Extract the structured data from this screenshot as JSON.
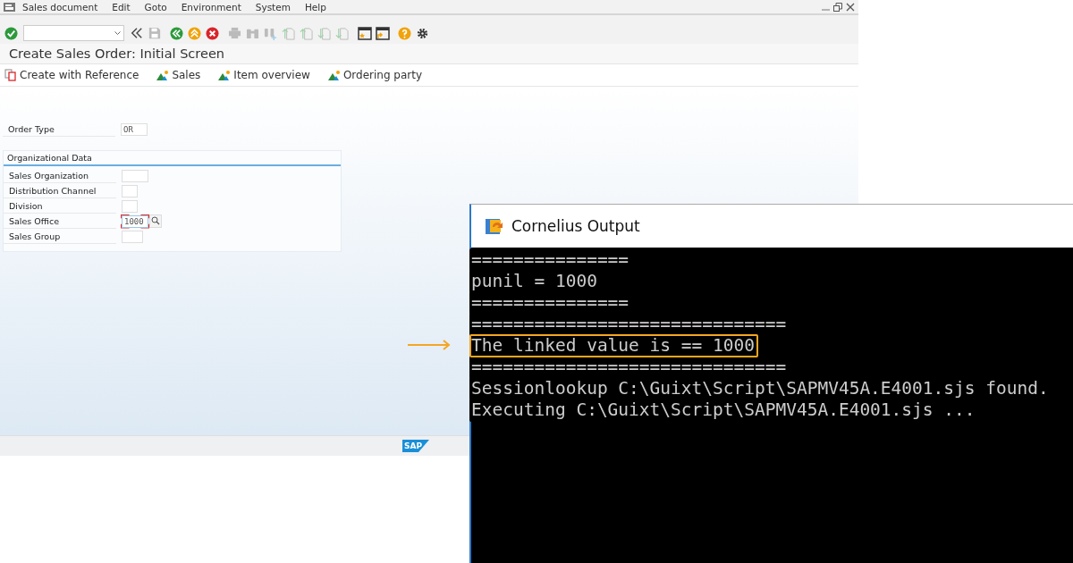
{
  "menu": [
    "Sales document",
    "Edit",
    "Goto",
    "Environment",
    "System",
    "Help"
  ],
  "toolbar": [
    {
      "kind": "check",
      "disabled": false
    },
    {
      "kind": "command"
    },
    {
      "kind": "collapse",
      "disabled": false
    },
    {
      "kind": "save",
      "disabled": true
    },
    {
      "kind": "back",
      "disabled": false
    },
    {
      "kind": "exit",
      "disabled": false
    },
    {
      "kind": "cancel",
      "disabled": false
    },
    {
      "kind": "print",
      "disabled": true
    },
    {
      "kind": "find",
      "disabled": true
    },
    {
      "kind": "find-next",
      "disabled": true
    },
    {
      "kind": "first-page",
      "disabled": true
    },
    {
      "kind": "prev-page",
      "disabled": true
    },
    {
      "kind": "next-page",
      "disabled": true
    },
    {
      "kind": "last-page",
      "disabled": true
    },
    {
      "kind": "new-window",
      "disabled": false
    },
    {
      "kind": "shortcut",
      "disabled": false
    },
    {
      "kind": "help",
      "disabled": false
    },
    {
      "kind": "settings",
      "disabled": false
    }
  ],
  "title": "Create Sales Order: Initial Screen",
  "app_toolbar": [
    {
      "kind": "reference",
      "label": "Create with Reference"
    },
    {
      "kind": "overview",
      "label": "Sales"
    },
    {
      "kind": "overview",
      "label": "Item overview"
    },
    {
      "kind": "overview",
      "label": "Ordering party"
    }
  ],
  "order_type": {
    "label": "Order Type",
    "value": "OR"
  },
  "org_data": {
    "title": "Organizational Data",
    "fields": [
      {
        "label": "Sales Organization",
        "focused": false
      },
      {
        "label": "Distribution Channel",
        "focused": false
      },
      {
        "label": "Division",
        "focused": false
      },
      {
        "label": "Sales Office",
        "value": "1000",
        "focused": true,
        "search_help": true
      },
      {
        "label": "Sales Group",
        "focused": false
      }
    ]
  },
  "sap_logo": "SAP",
  "console": {
    "title": "Cornelius Output",
    "lines": [
      {
        "text": "===============",
        "highlighted": false
      },
      {
        "text": "punil = 1000",
        "highlighted": false
      },
      {
        "text": "===============",
        "highlighted": false
      },
      {
        "text": "==============================",
        "highlighted": false
      },
      {
        "text": "The linked value is == 1000",
        "highlighted": true
      },
      {
        "text": "==============================",
        "highlighted": false
      },
      {
        "text": "Sessionlookup C:\\Guixt\\Script\\SAPMV45A.E4001.sjs found.",
        "highlighted": false
      },
      {
        "text": "Executing C:\\Guixt\\Script\\SAPMV45A.E4001.sjs ...",
        "highlighted": false
      }
    ]
  }
}
